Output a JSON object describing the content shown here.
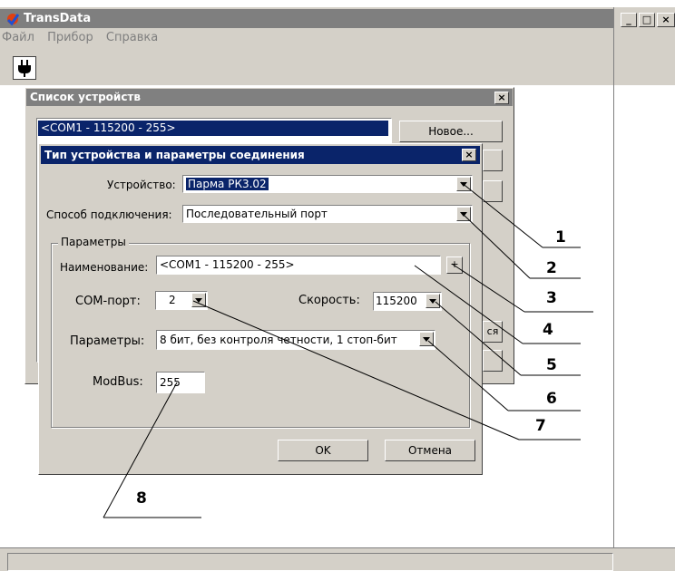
{
  "app": {
    "title": "TransData",
    "menu": [
      "Файл",
      "Прибор",
      "Справка"
    ],
    "window_controls": [
      "_",
      "□",
      "×"
    ]
  },
  "device_list_dialog": {
    "title": "Список устройств",
    "selected_item": "<COM1 - 115200 - 255>",
    "new_button": "Новое...",
    "partial_button": "ся"
  },
  "connection_dialog": {
    "title": "Тип устройства и параметры соединения",
    "device_label": "Устройство:",
    "device_value": "Парма РК3.02",
    "connection_label": "Способ подключения:",
    "connection_value": "Последовательный порт",
    "group_label": "Параметры",
    "name_label": "Наименование:",
    "name_value": "<COM1 - 115200 - 255>",
    "plus_button": "+",
    "com_label": "COM-порт:",
    "com_value": "2",
    "speed_label": "Скорость:",
    "speed_value": "115200",
    "params_label": "Параметры:",
    "params_value": "8 бит, без контроля четности, 1 стоп-бит",
    "modbus_label": "ModBus:",
    "modbus_value": "255",
    "ok_button": "OK",
    "cancel_button": "Отмена"
  },
  "callouts": [
    "1",
    "2",
    "3",
    "4",
    "5",
    "6",
    "7",
    "8"
  ],
  "colors": {
    "title_active": "#0a246a",
    "title_inactive": "#808080",
    "face": "#d4d0c8"
  }
}
